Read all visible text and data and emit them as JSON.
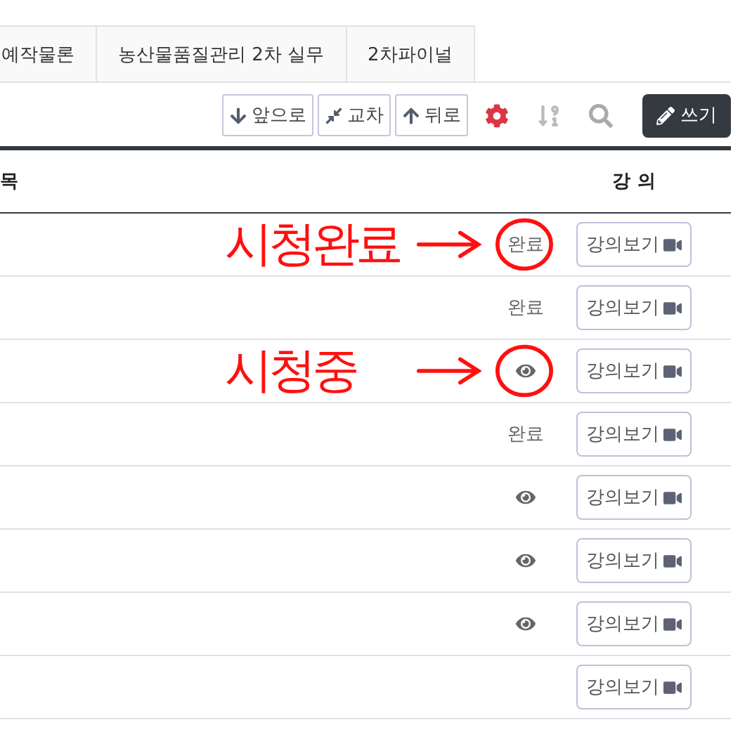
{
  "tabs": [
    {
      "label": "예작물론",
      "selected": false
    },
    {
      "label": "농산물품질관리 2차 실무",
      "selected": false
    },
    {
      "label": "2차파이널",
      "selected": false
    }
  ],
  "toolbar": [
    {
      "kind": "outline",
      "label": "앞으로"
    },
    {
      "kind": "outline",
      "label": "교차"
    },
    {
      "kind": "outline",
      "label": "뒤로"
    },
    {
      "kind": "icon"
    },
    {
      "kind": "icon"
    },
    {
      "kind": "icon"
    },
    {
      "kind": "dark",
      "label": "쓰기"
    }
  ],
  "table": {
    "columns": [
      "목",
      "강 의"
    ],
    "rows": [
      {
        "kind": "done",
        "status": "완료",
        "button": "강의보기",
        "annotation": "시청완료"
      },
      {
        "kind": "done",
        "status": "완료",
        "button": "강의보기"
      },
      {
        "kind": "watching",
        "button": "강의보기",
        "annotation": "시청중"
      },
      {
        "kind": "done",
        "status": "완료",
        "button": "강의보기"
      },
      {
        "kind": "watching",
        "button": "강의보기"
      },
      {
        "kind": "watching",
        "button": "강의보기"
      },
      {
        "kind": "watching",
        "button": "강의보기"
      },
      {
        "kind": "none",
        "button": "강의보기"
      }
    ]
  }
}
